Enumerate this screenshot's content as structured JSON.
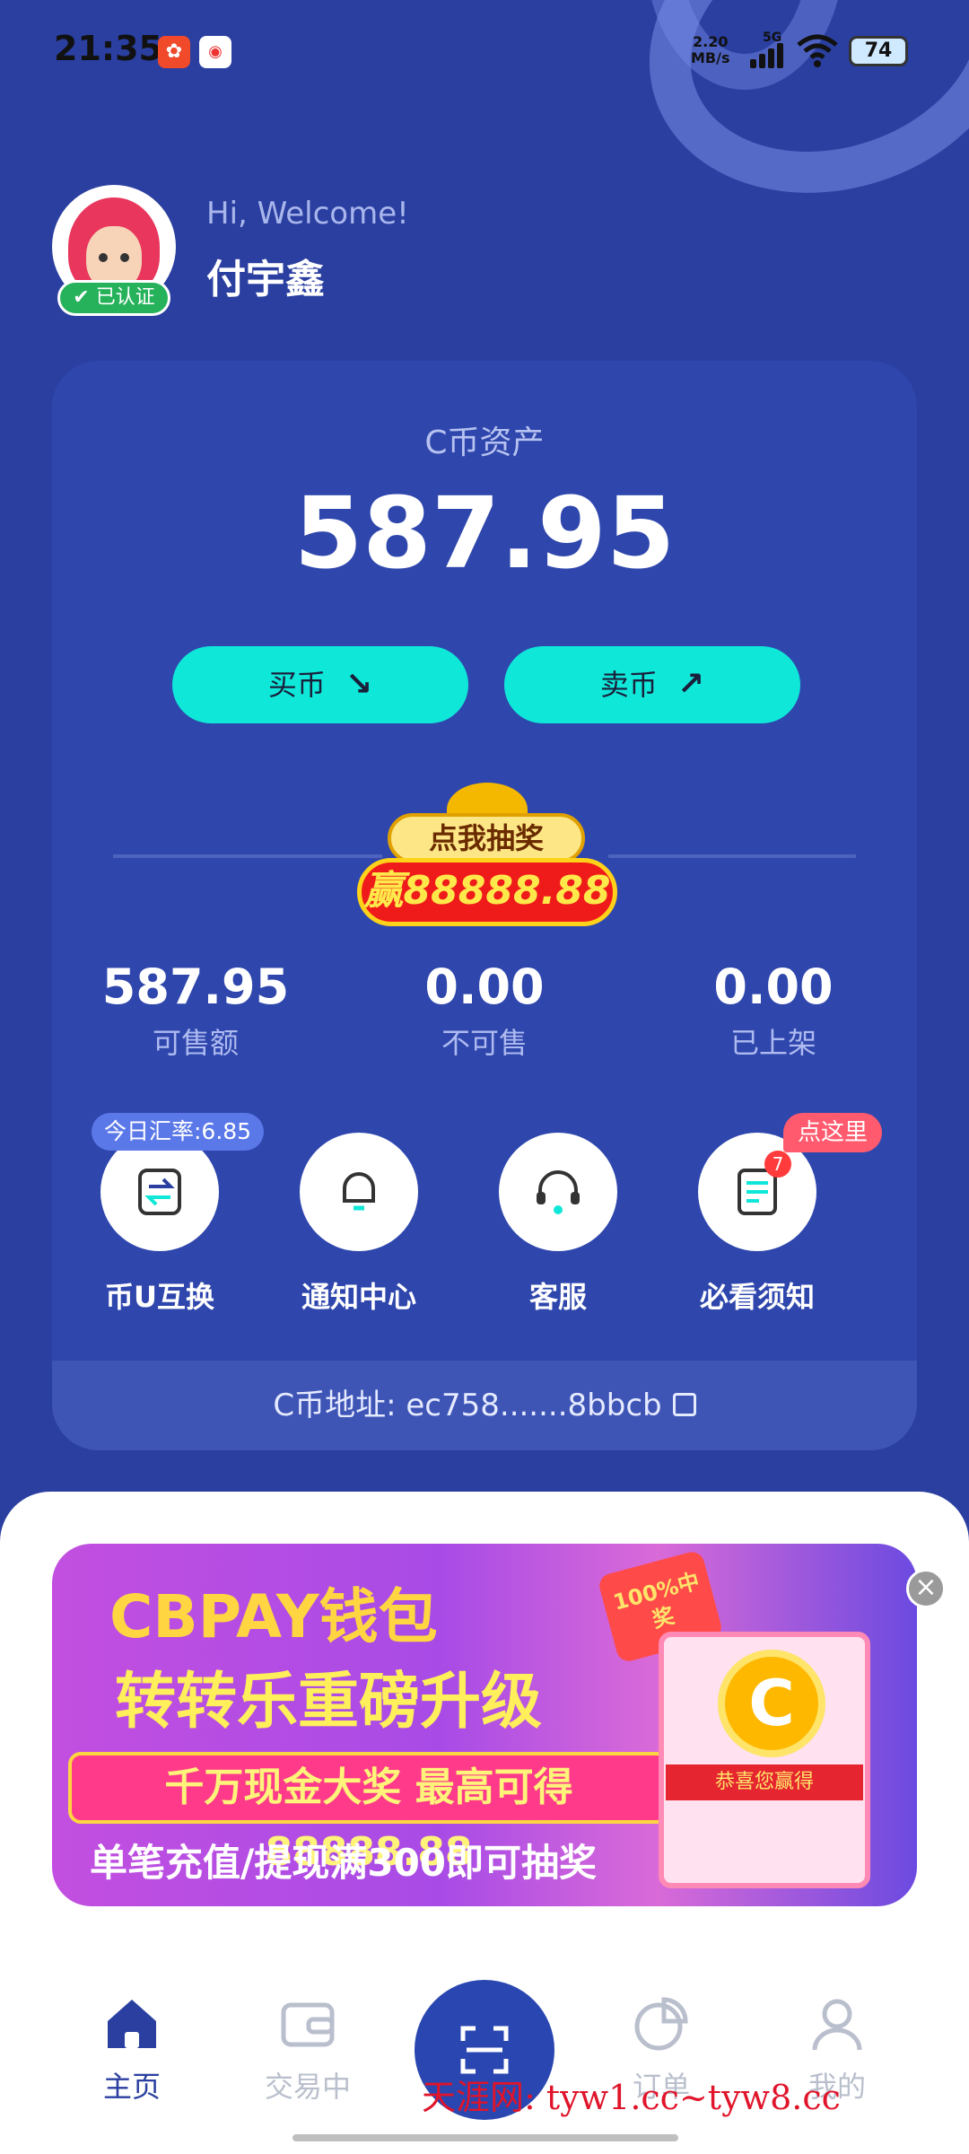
{
  "status_bar": {
    "time": "21:35",
    "net_speed": "2.20",
    "net_unit": "MB/s",
    "network": "5G",
    "battery": "74"
  },
  "header": {
    "greeting": "Hi, Welcome!",
    "username": "付宇鑫",
    "verified_label": "已认证"
  },
  "asset": {
    "label": "C币资产",
    "amount": "587.95",
    "buy_label": "买币",
    "sell_label": "卖币"
  },
  "lottery": {
    "top_text": "点我抽奖",
    "bottom_text": "赢88888.88"
  },
  "stats": [
    {
      "value": "587.95",
      "label": "可售额"
    },
    {
      "value": "0.00",
      "label": "不可售"
    },
    {
      "value": "0.00",
      "label": "已上架"
    }
  ],
  "functions": [
    {
      "label": "币U互换"
    },
    {
      "label": "通知中心"
    },
    {
      "label": "客服"
    },
    {
      "label": "必看须知"
    }
  ],
  "rate_tip": "今日汇率:6.85",
  "click_tip": "点这里",
  "notice_count": "7",
  "address": {
    "text": "C币地址: ec758.......8bbcb"
  },
  "banner": {
    "title": "CBPAY钱包",
    "subtitle": "转转乐重磅升级",
    "highlight": "千万现金大奖 最高可得88888.88",
    "note": "单笔充值/提现满300即可抽奖",
    "stamp": "100%中奖",
    "ribbon": "恭喜您赢得"
  },
  "nav": [
    {
      "label": "主页",
      "active": true
    },
    {
      "label": "交易中"
    },
    {
      "label": "订单"
    },
    {
      "label": "我的"
    }
  ],
  "watermark": "天涯网: tyw1.cc~tyw8.cc",
  "colors": {
    "primary": "#2a3fa0",
    "accent": "#0fe8d9",
    "verified": "#25b25a"
  }
}
